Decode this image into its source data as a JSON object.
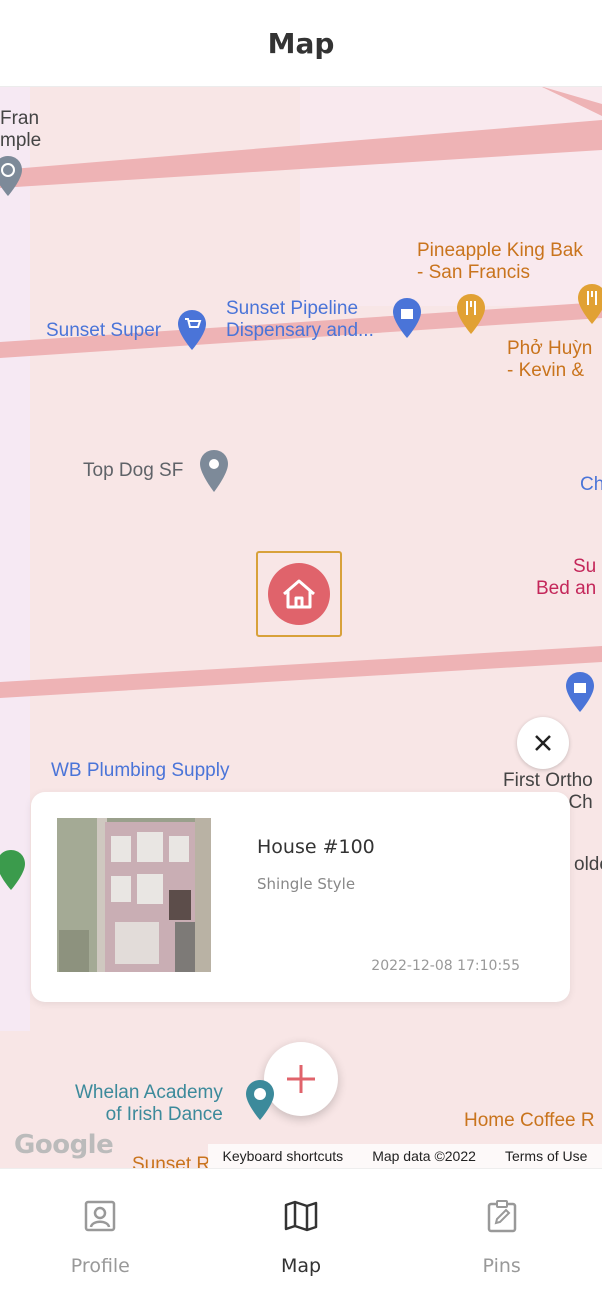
{
  "header": {
    "title": "Map"
  },
  "map": {
    "labels": {
      "temple": "Fran\nmple",
      "pineapple": "Pineapple King Bak\n- San Francis",
      "sunset_super": "Sunset Super",
      "sunset_pipeline": "Sunset Pipeline\nDispensary and...",
      "pho": "Phở Huỳn\n- Kevin &",
      "top_dog": "Top Dog SF",
      "ch": "Ch",
      "su": "Su\nBed an",
      "wb_plumbing": "WB Plumbing Supply",
      "first_ortho": "First Ortho\nCh",
      "olde": "olde",
      "whelan": "Whelan Academy\nof Irish Dance",
      "home_coffee": "Home Coffee R",
      "sunset_bottom": "Sunset R"
    },
    "attribution": {
      "logo": "Google",
      "keyboard": "Keyboard shortcuts",
      "mapdata": "Map data ©2022",
      "terms": "Terms of Use"
    }
  },
  "card": {
    "title": "House #100",
    "style": "Shingle Style",
    "timestamp": "2022-12-08 17:10:55"
  },
  "tabs": [
    {
      "label": "Profile",
      "icon": "profile-icon",
      "active": false
    },
    {
      "label": "Map",
      "icon": "map-icon",
      "active": true
    },
    {
      "label": "Pins",
      "icon": "clipboard-edit-icon",
      "active": false
    }
  ],
  "colors": {
    "accent": "#e0636b",
    "marker_border": "#d8a13a",
    "road": "#eeb3b5",
    "map_bg": "#f8e6e6"
  }
}
